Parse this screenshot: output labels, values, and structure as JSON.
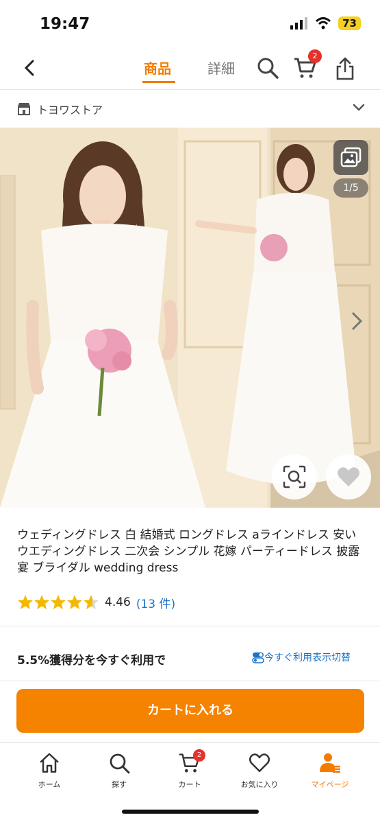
{
  "status": {
    "time": "19:47",
    "battery": "73"
  },
  "nav": {
    "tab_goods": "商品",
    "tab_detail": "詳細",
    "cart_badge": "2"
  },
  "store": {
    "name": "トヨワストア"
  },
  "gallery": {
    "counter": "1/5"
  },
  "product": {
    "title": "ウェディングドレス 白 結婚式 ロングドレス aラインドレス 安い ウエディングドレス 二次会 シンプル 花嫁 パーティードレス 披露宴 ブライダル wedding dress",
    "rating": 4.46,
    "rating_text": "4.46",
    "review_count": "(13 件)"
  },
  "points": {
    "label": "5.5%獲得分を今すぐ利用で",
    "switch_label": "今すぐ利用表示切替"
  },
  "cart_button": {
    "label": "カートに入れる"
  },
  "tabbar": {
    "home": "ホーム",
    "search": "探す",
    "cart": "カート",
    "cart_badge": "2",
    "favorites": "お気に入り",
    "mypage": "マイページ"
  },
  "colors": {
    "accent": "#f47a00",
    "cart_button": "#f58300",
    "link": "#1a73c8",
    "badge": "#e5322d",
    "star": "#f5b800"
  }
}
